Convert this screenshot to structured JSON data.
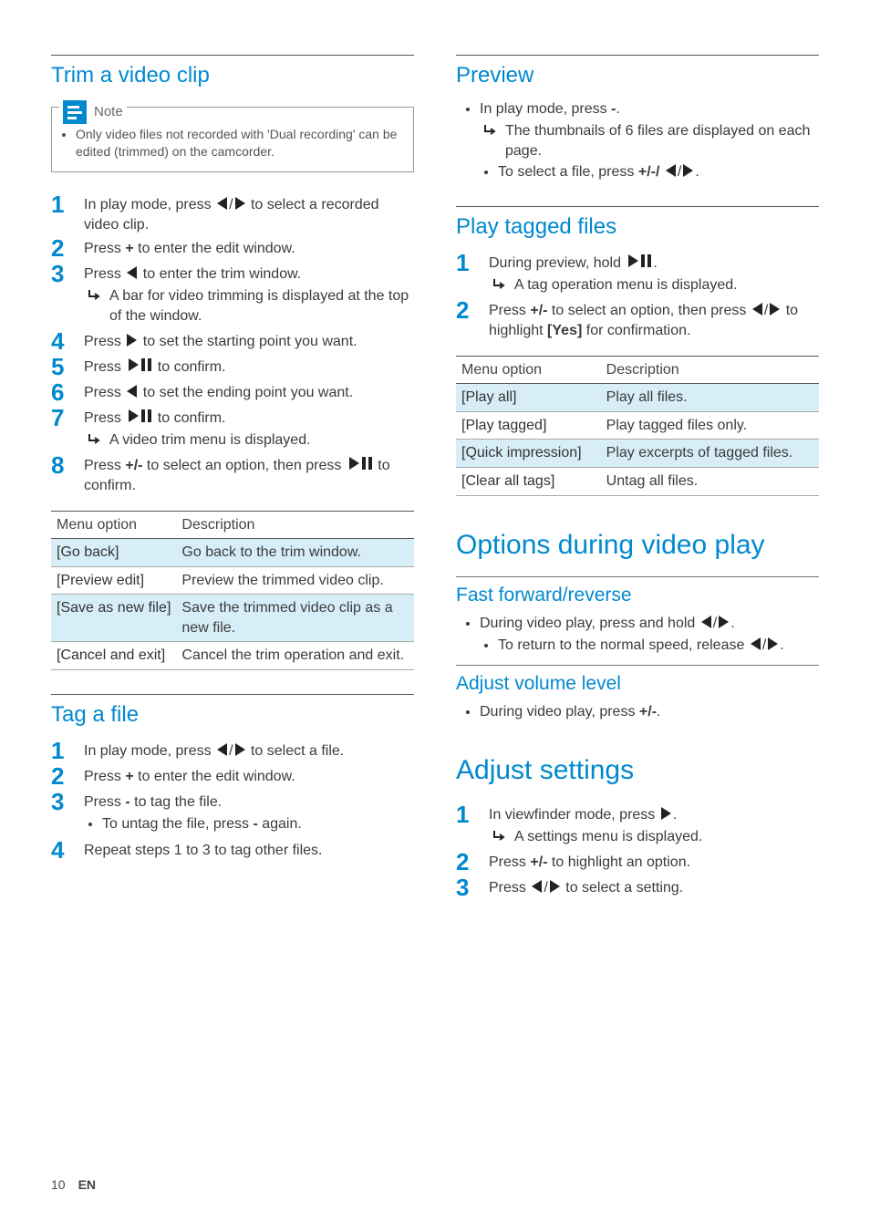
{
  "footer": {
    "page_number": "10",
    "lang": "EN"
  },
  "left": {
    "trim": {
      "title": "Trim a video clip",
      "note_label": "Note",
      "note_text": "Only video files not recorded with 'Dual recording' can be edited (trimmed) on the camcorder.",
      "steps": {
        "s1a": "In play mode, press ",
        "s1b": " to select a recorded video clip.",
        "s2a": "Press ",
        "s2b": "+",
        "s2c": " to enter the edit window.",
        "s3a": "Press ",
        "s3b": " to enter the trim window.",
        "s3_res": "A bar for video trimming is displayed at the top of the window.",
        "s4a": "Press ",
        "s4b": " to set the starting point you want.",
        "s5a": "Press ",
        "s5b": " to confirm.",
        "s6a": "Press ",
        "s6b": " to set the ending point you want.",
        "s7a": "Press ",
        "s7b": " to confirm.",
        "s7_res": "A video trim menu is displayed.",
        "s8a": "Press ",
        "s8b": "+/-",
        "s8c": " to select an option, then press ",
        "s8d": " to confirm."
      },
      "table": {
        "headers": {
          "option": "Menu option",
          "desc": "Description"
        },
        "rows": [
          {
            "option": "[Go back]",
            "desc": "Go back to the trim window."
          },
          {
            "option": "[Preview edit]",
            "desc": "Preview the trimmed video clip."
          },
          {
            "option": "[Save as new file]",
            "desc": "Save the trimmed video clip as a new file."
          },
          {
            "option": "[Cancel and exit]",
            "desc": "Cancel the trim operation and exit."
          }
        ]
      }
    },
    "tag": {
      "title": "Tag a file",
      "steps": {
        "s1a": "In play mode, press ",
        "s1b": " to select a file.",
        "s2a": "Press ",
        "s2b": "+",
        "s2c": " to enter the edit window.",
        "s3a": "Press ",
        "s3b": "-",
        "s3c": " to tag the file.",
        "s3_sub_a": "To untag the file, press ",
        "s3_sub_b": "-",
        "s3_sub_c": " again.",
        "s4": "Repeat steps 1 to 3 to tag other files."
      }
    }
  },
  "right": {
    "preview": {
      "title": "Preview",
      "b1a": "In play mode, press ",
      "b1b": "-",
      "b1c": ".",
      "b1_res": "The thumbnails of 6 files are displayed on each page.",
      "b1_sub_a": "To select a file, press ",
      "b1_sub_b": "+/-/ ",
      "b1_sub_c": "."
    },
    "play_tagged": {
      "title": "Play tagged files",
      "s1a": "During preview, hold ",
      "s1b": ".",
      "s1_res": "A tag operation menu is displayed.",
      "s2a": "Press ",
      "s2b": "+/-",
      "s2c": " to select an option, then press ",
      "s2d": " to highlight ",
      "s2e": "[Yes]",
      "s2f": " for confirmation.",
      "table": {
        "headers": {
          "option": "Menu option",
          "desc": "Description"
        },
        "rows": [
          {
            "option": "[Play all]",
            "desc": "Play all files."
          },
          {
            "option": "[Play tagged]",
            "desc": "Play tagged files only."
          },
          {
            "option": "[Quick impression]",
            "desc": "Play excerpts of tagged files."
          },
          {
            "option": "[Clear all tags]",
            "desc": "Untag all files."
          }
        ]
      }
    },
    "options_title": "Options during video play",
    "ffwd": {
      "title": "Fast forward/reverse",
      "b1a": "During video play, press and hold ",
      "b1b": ".",
      "b1_sub_a": "To return to the normal speed, release ",
      "b1_sub_b": "."
    },
    "volume": {
      "title": "Adjust volume level",
      "b1a": "During video play, press ",
      "b1b": "+/-",
      "b1c": "."
    },
    "adjust_title": "Adjust settings",
    "adjust": {
      "s1a": "In viewfinder mode, press ",
      "s1b": ".",
      "s1_res": "A settings menu is displayed.",
      "s2a": "Press ",
      "s2b": "+/-",
      "s2c": " to highlight an option.",
      "s3a": "Press ",
      "s3b": " to select a setting."
    }
  }
}
